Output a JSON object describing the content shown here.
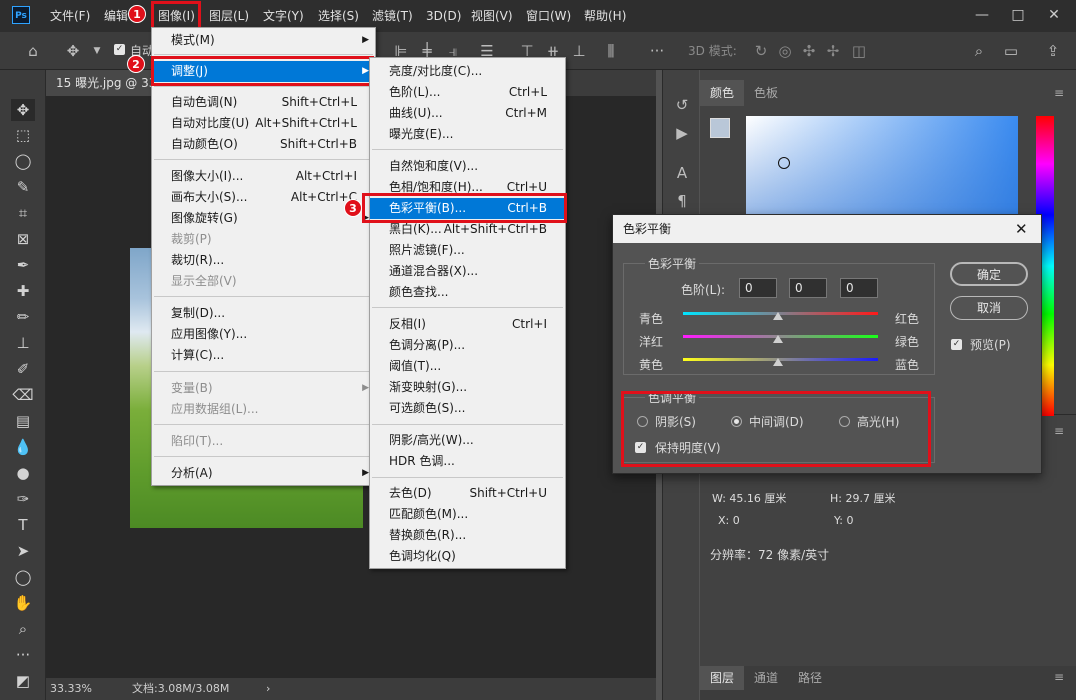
{
  "app": {
    "logo": "Ps"
  },
  "menubar": {
    "items": [
      "文件(F)",
      "编辑",
      "图像(I)",
      "图层(L)",
      "文字(Y)",
      "选择(S)",
      "滤镜(T)",
      "3D(D)",
      "视图(V)",
      "窗口(W)",
      "帮助(H)"
    ],
    "window_controls": [
      "—",
      "□",
      "✕"
    ]
  },
  "options_bar": {
    "auto_label": "自动",
    "mode_3d": "3D 模式:"
  },
  "document": {
    "tab_title": "15 曝光.jpg @ 33",
    "zoom": "33.33%",
    "doc_size": "文档:3.08M/3.08M"
  },
  "image_menu": {
    "items": [
      {
        "label": "模式(M)",
        "shortcut": "",
        "submenu": true,
        "disabled": false
      },
      {
        "label": "调整(J)",
        "shortcut": "",
        "submenu": true,
        "disabled": false,
        "highlight": true
      },
      {
        "label": "自动色调(N)",
        "shortcut": "Shift+Ctrl+L"
      },
      {
        "label": "自动对比度(U)",
        "shortcut": "Alt+Shift+Ctrl+L"
      },
      {
        "label": "自动颜色(O)",
        "shortcut": "Shift+Ctrl+B"
      },
      {
        "label": "图像大小(I)...",
        "shortcut": "Alt+Ctrl+I"
      },
      {
        "label": "画布大小(S)...",
        "shortcut": "Alt+Ctrl+C"
      },
      {
        "label": "图像旋转(G)",
        "shortcut": "",
        "submenu": true
      },
      {
        "label": "裁剪(P)",
        "shortcut": "",
        "disabled": true
      },
      {
        "label": "裁切(R)...",
        "shortcut": ""
      },
      {
        "label": "显示全部(V)",
        "shortcut": "",
        "disabled": true
      },
      {
        "label": "复制(D)...",
        "shortcut": ""
      },
      {
        "label": "应用图像(Y)...",
        "shortcut": ""
      },
      {
        "label": "计算(C)...",
        "shortcut": ""
      },
      {
        "label": "变量(B)",
        "shortcut": "",
        "submenu": true,
        "disabled": true
      },
      {
        "label": "应用数据组(L)...",
        "shortcut": "",
        "disabled": true
      },
      {
        "label": "陷印(T)...",
        "shortcut": "",
        "disabled": true
      },
      {
        "label": "分析(A)",
        "shortcut": "",
        "submenu": true
      }
    ]
  },
  "adjust_menu": {
    "items": [
      {
        "label": "亮度/对比度(C)...",
        "shortcut": ""
      },
      {
        "label": "色阶(L)...",
        "shortcut": "Ctrl+L"
      },
      {
        "label": "曲线(U)...",
        "shortcut": "Ctrl+M"
      },
      {
        "label": "曝光度(E)...",
        "shortcut": ""
      },
      {
        "label": "自然饱和度(V)...",
        "shortcut": ""
      },
      {
        "label": "色相/饱和度(H)...",
        "shortcut": "Ctrl+U"
      },
      {
        "label": "色彩平衡(B)...",
        "shortcut": "Ctrl+B",
        "highlight": true
      },
      {
        "label": "黑白(K)...",
        "shortcut": "Alt+Shift+Ctrl+B"
      },
      {
        "label": "照片滤镜(F)...",
        "shortcut": ""
      },
      {
        "label": "通道混合器(X)...",
        "shortcut": ""
      },
      {
        "label": "颜色查找...",
        "shortcut": ""
      },
      {
        "label": "反相(I)",
        "shortcut": "Ctrl+I"
      },
      {
        "label": "色调分离(P)...",
        "shortcut": ""
      },
      {
        "label": "阈值(T)...",
        "shortcut": ""
      },
      {
        "label": "渐变映射(G)...",
        "shortcut": ""
      },
      {
        "label": "可选颜色(S)...",
        "shortcut": ""
      },
      {
        "label": "阴影/高光(W)...",
        "shortcut": ""
      },
      {
        "label": "HDR 色调...",
        "shortcut": ""
      },
      {
        "label": "去色(D)",
        "shortcut": "Shift+Ctrl+U"
      },
      {
        "label": "匹配颜色(M)...",
        "shortcut": ""
      },
      {
        "label": "替换颜色(R)...",
        "shortcut": ""
      },
      {
        "label": "色调均化(Q)",
        "shortcut": ""
      }
    ]
  },
  "badges": [
    "1",
    "2",
    "3"
  ],
  "panels": {
    "color_tabs": [
      "颜色",
      "色板"
    ],
    "bottom_tabs": [
      "图层",
      "通道",
      "路径"
    ],
    "info": {
      "w": "W:  45.16  厘米",
      "h": "H:  29.7  厘米",
      "x": "X:  0",
      "y": "Y:  0",
      "resolution": "分辨率：72 像素/英寸"
    }
  },
  "dialog": {
    "title": "色彩平衡",
    "group_color_balance": "色彩平衡",
    "levels_label": "色阶(L):",
    "levels": [
      "0",
      "0",
      "0"
    ],
    "slider_labels_left": [
      "青色",
      "洋红",
      "黄色"
    ],
    "slider_labels_right": [
      "红色",
      "绿色",
      "蓝色"
    ],
    "slider_positions": [
      0.5,
      0.5,
      0.5
    ],
    "group_tone_balance": "色调平衡",
    "tone_options": [
      "阴影(S)",
      "中间调(D)",
      "高光(H)"
    ],
    "tone_selected": 1,
    "preserve_luminosity": "保持明度(V)",
    "ok": "确定",
    "cancel": "取消",
    "preview": "预览(P)"
  }
}
